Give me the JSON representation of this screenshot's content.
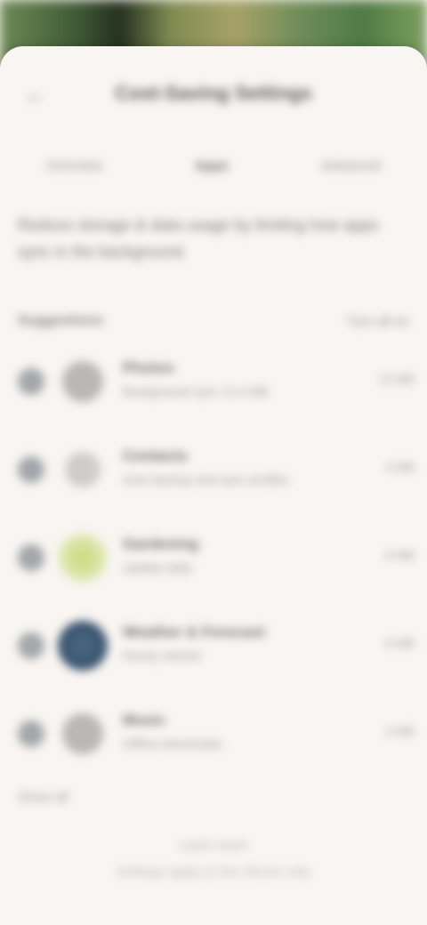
{
  "header": {
    "back_icon": "←",
    "title": "Cost-Saving Settings"
  },
  "tabs": [
    {
      "label": "Overview",
      "active": false
    },
    {
      "label": "Apps",
      "active": true
    },
    {
      "label": "Advanced",
      "active": false
    }
  ],
  "description": "Reduce storage & data usage by limiting how apps sync in the background.",
  "section": {
    "title": "Suggestions",
    "action": "Turn all on"
  },
  "items": [
    {
      "title": "Photos",
      "subtitle": "Background sync 12.4 MB",
      "size": "12 MB",
      "icon": "photos-icon"
    },
    {
      "title": "Contacts",
      "subtitle": "Auto backup and sync profiles",
      "size": "4 MB",
      "icon": "contacts-icon"
    },
    {
      "title": "Gardening",
      "subtitle": "Update daily",
      "size": "8 MB",
      "icon": "gardening-icon"
    },
    {
      "title": "Weather & Forecast",
      "subtitle": "Hourly refresh",
      "size": "6 MB",
      "icon": "weather-icon"
    },
    {
      "title": "Music",
      "subtitle": "Offline downloads",
      "size": "3 MB",
      "icon": "music-icon"
    }
  ],
  "show_more": "Show all",
  "footer": {
    "line1": "Learn more",
    "line2": "Settings apply to this device only"
  }
}
